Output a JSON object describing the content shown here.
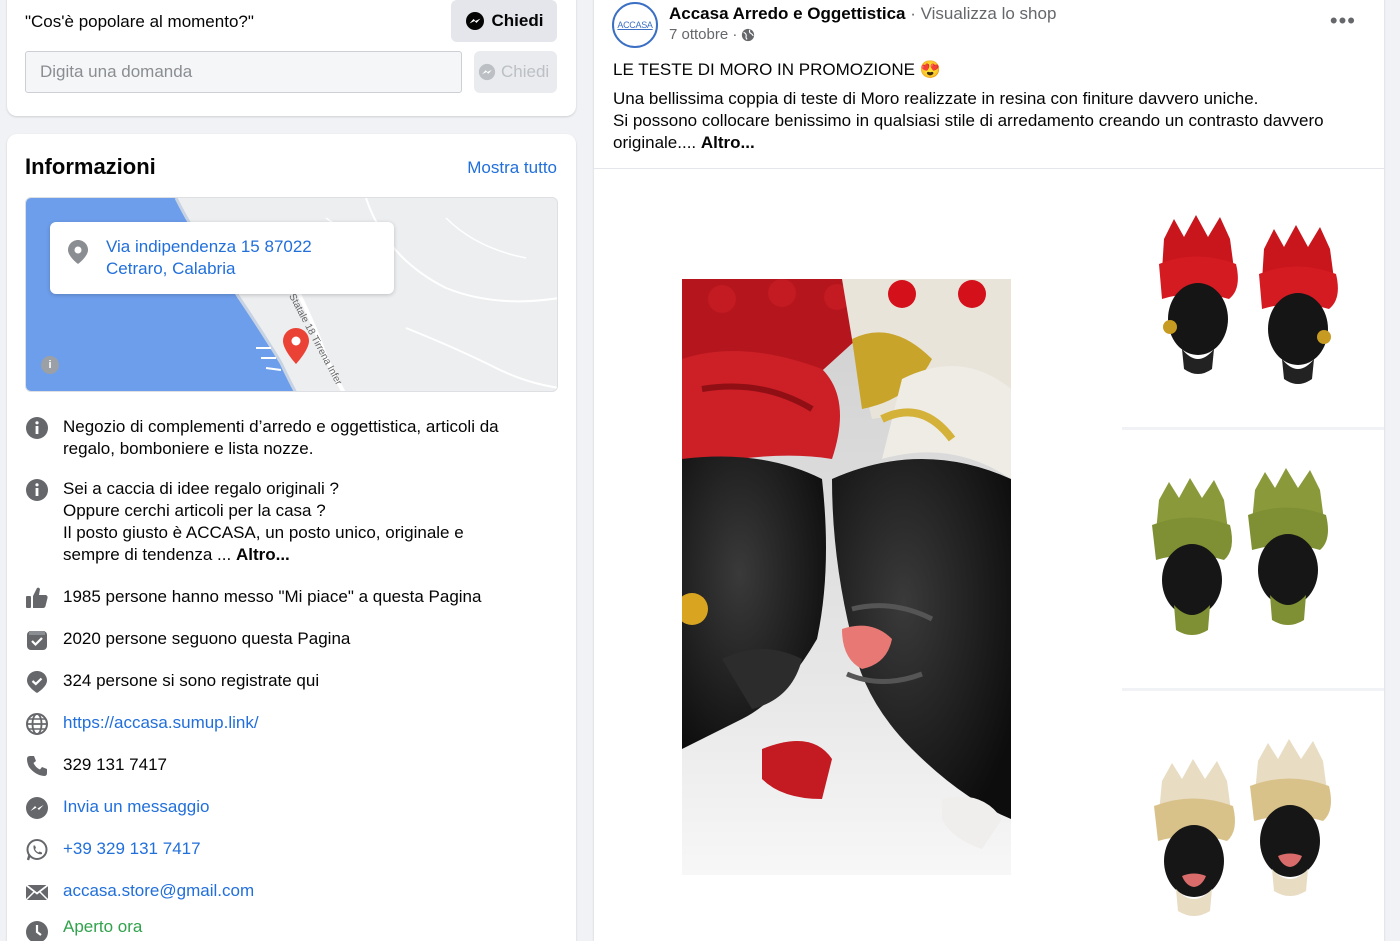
{
  "ask": {
    "question": "\"Cos'è popolare al momento?\"",
    "button_label": "Chiedi",
    "input_placeholder": "Digita una domanda",
    "disabled_button_label": "Chiedi"
  },
  "info": {
    "title": "Informazioni",
    "show_all": "Mostra tutto",
    "address_line1": "Via indipendenza 15 87022",
    "address_line2": "Cetraro, Calabria",
    "map_road_label": "Statale 18 Tirrena Infer",
    "rows": {
      "description": "Negozio di complementi d’arredo e oggettistica, articoli da regalo, bomboniere e lista nozze.",
      "about_line1": "Sei a caccia di idee regalo originali ?",
      "about_line2": "Oppure cerchi articoli per la casa ?",
      "about_line3": "Il posto giusto è ACCASA, un posto unico, originale e",
      "about_line4": "sempre di tendenza ... ",
      "about_more": "Altro...",
      "likes": "1985 persone hanno messo \"Mi piace\" a questa Pagina",
      "followers": "2020 persone seguono questa Pagina",
      "checkins": "324 persone si sono registrate qui",
      "website": "https://accasa.sumup.link/",
      "phone": "329 131 7417",
      "message": "Invia un messaggio",
      "whatsapp": "+39 329 131 7417",
      "email": "accasa.store@gmail.com",
      "hours": "Aperto ora"
    },
    "icons": [
      "info-icon",
      "info-icon",
      "thumbs-up-icon",
      "follow-icon",
      "checkin-icon",
      "globe-icon",
      "phone-icon",
      "messenger-icon",
      "whatsapp-icon",
      "mail-icon",
      "clock-icon"
    ]
  },
  "post": {
    "avatar_text": "ACCASA",
    "author": "Accasa Arredo e Oggettistica",
    "separator": " · ",
    "shop_link": "Visualizza lo shop",
    "date": "7 ottobre ·",
    "headline": "LE TESTE DI MORO IN PROMOZIONE 😍",
    "body_line1": "Una bellissima coppia di teste di Moro realizzate in resina con finiture davvero uniche.",
    "body_line2": "Si possono collocare benissimo in qualsiasi stile di arredamento creando un contrasto davvero originale.... ",
    "body_more": "Altro...",
    "more_menu": "•••"
  },
  "colors": {
    "link": "#216fdb",
    "open_green": "#31a24c",
    "map_sea": "#6d9eeb",
    "map_land": "#eceef0",
    "pin": "#ea4335"
  }
}
